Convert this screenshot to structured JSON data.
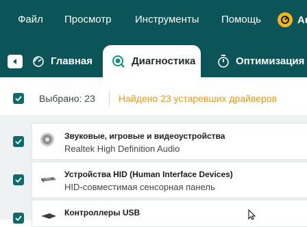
{
  "menu": {
    "file": "Файл",
    "view": "Просмотр",
    "tools": "Инструменты",
    "help": "Помощь",
    "brand": "Au"
  },
  "tabs": {
    "home": "Главная",
    "diagnostics": "Диагностика",
    "optimization": "Оптимизация"
  },
  "selection": {
    "selected": "Выбрано: 23",
    "found": "Найдено 23 устаревших драйверов"
  },
  "devices": [
    {
      "category": "Звуковые, игровые и видеоустройства",
      "name": "Realtek High Definition Audio",
      "icon": "speaker-icon"
    },
    {
      "category": "Устройства HID (Human Interface Devices)",
      "name": "HID-совместимая сенсорная панель",
      "icon": "hid-device-icon"
    },
    {
      "category": "Контроллеры USB",
      "name": "",
      "icon": "usb-controller-icon"
    }
  ],
  "colors": {
    "header": "#0b5457",
    "accent_orange": "#e8961e",
    "checkbox": "#0e6b6b"
  }
}
